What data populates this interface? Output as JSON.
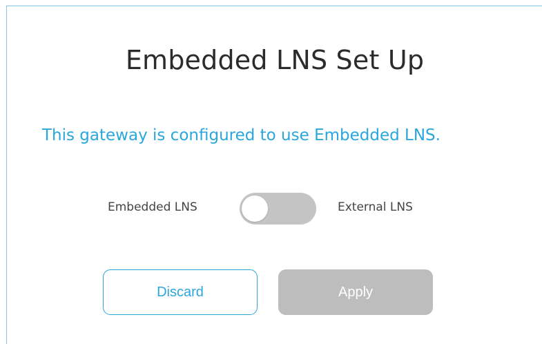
{
  "page": {
    "title": "Embedded LNS Set Up",
    "status_message": "This gateway is configured to use Embedded LNS."
  },
  "lns_toggle": {
    "left_label": "Embedded LNS",
    "right_label": "External LNS",
    "selected": "Embedded LNS",
    "state": "off"
  },
  "actions": {
    "discard_label": "Discard",
    "apply_label": "Apply",
    "apply_enabled": false
  },
  "colors": {
    "accent": "#2aa6dc",
    "toggle_track": "#c4c4c4",
    "disabled_button": "#bdbdbd",
    "title_text": "#2b2b2b"
  }
}
